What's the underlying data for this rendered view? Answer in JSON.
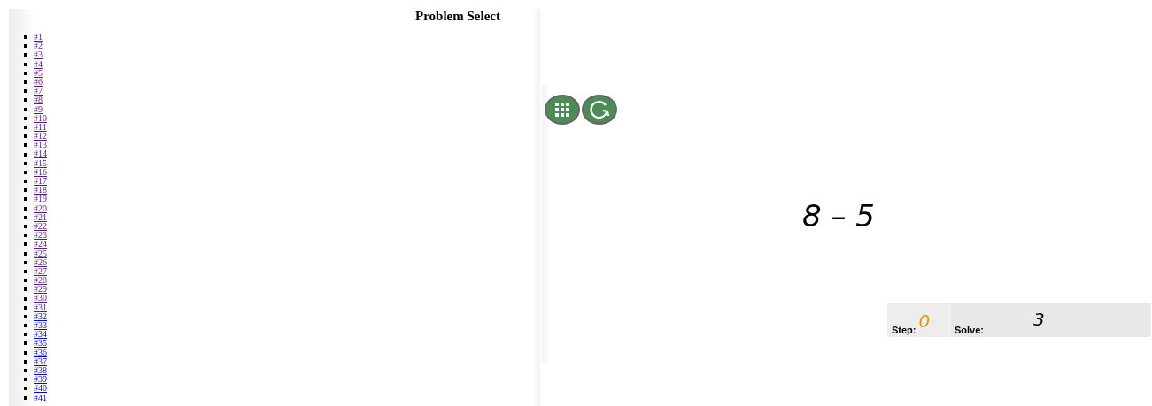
{
  "title": "Problem Select",
  "problems": [
    {
      "label": "#1",
      "visited": true
    },
    {
      "label": "#2",
      "visited": true
    },
    {
      "label": "#3",
      "visited": true
    },
    {
      "label": "#4",
      "visited": true
    },
    {
      "label": "#5",
      "visited": true
    },
    {
      "label": "#6",
      "visited": true
    },
    {
      "label": "#7",
      "visited": true
    },
    {
      "label": "#8",
      "visited": true
    },
    {
      "label": "#9",
      "visited": true
    },
    {
      "label": "#10",
      "visited": true
    },
    {
      "label": "#11",
      "visited": true
    },
    {
      "label": "#12",
      "visited": true
    },
    {
      "label": "#13",
      "visited": true
    },
    {
      "label": "#14",
      "visited": true
    },
    {
      "label": "#15",
      "visited": true
    },
    {
      "label": "#16",
      "visited": true
    },
    {
      "label": "#17",
      "visited": true
    },
    {
      "label": "#18",
      "visited": true
    },
    {
      "label": "#19",
      "visited": true
    },
    {
      "label": "#20",
      "visited": true
    },
    {
      "label": "#21",
      "visited": true
    },
    {
      "label": "#22",
      "visited": true
    },
    {
      "label": "#23",
      "visited": true
    },
    {
      "label": "#24",
      "visited": true
    },
    {
      "label": "#25",
      "visited": true
    },
    {
      "label": "#26",
      "visited": true
    },
    {
      "label": "#27",
      "visited": true
    },
    {
      "label": "#28",
      "visited": true
    },
    {
      "label": "#29",
      "visited": true
    },
    {
      "label": "#30",
      "visited": true
    },
    {
      "label": "#31",
      "visited": true
    },
    {
      "label": "#32",
      "visited": false
    },
    {
      "label": "#33",
      "visited": false
    },
    {
      "label": "#34",
      "visited": false
    },
    {
      "label": "#35",
      "visited": false
    },
    {
      "label": "#36",
      "visited": false
    },
    {
      "label": "#37",
      "visited": false
    },
    {
      "label": "#38",
      "visited": false
    },
    {
      "label": "#39",
      "visited": false
    },
    {
      "label": "#40",
      "visited": false
    },
    {
      "label": "#41",
      "visited": false
    }
  ],
  "problem": "8 – 5",
  "score": {
    "step_label": "Step:",
    "step": "0",
    "solve_label": "Solve:",
    "solve": "3"
  }
}
